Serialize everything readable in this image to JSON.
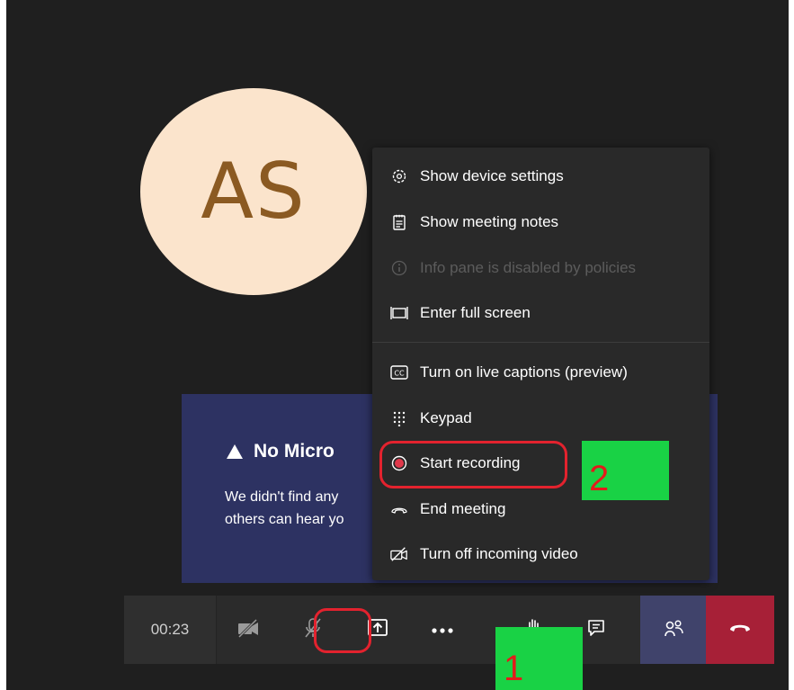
{
  "avatar": {
    "initials": "AS"
  },
  "notice": {
    "title": "No Micro",
    "body": "We didn't find any others can hear yo"
  },
  "menu": {
    "items": [
      {
        "label": "Show device settings",
        "icon": "gear-icon",
        "enabled": true
      },
      {
        "label": "Show meeting notes",
        "icon": "notes-icon",
        "enabled": true
      },
      {
        "label": "Info pane is disabled by policies",
        "icon": "info-icon",
        "enabled": false
      },
      {
        "label": "Enter full screen",
        "icon": "fullscreen-icon",
        "enabled": true
      },
      {
        "label": "Turn on live captions (preview)",
        "icon": "captions-icon",
        "enabled": true
      },
      {
        "label": "Keypad",
        "icon": "keypad-icon",
        "enabled": true
      },
      {
        "label": "Start recording",
        "icon": "record-icon",
        "enabled": true
      },
      {
        "label": "End meeting",
        "icon": "end-call-icon",
        "enabled": true
      },
      {
        "label": "Turn off incoming video",
        "icon": "video-off-icon",
        "enabled": true
      }
    ]
  },
  "annotations": {
    "step1": "1",
    "step2": "2",
    "highlight_color": "#e3222e",
    "callout_color": "#19d245"
  },
  "toolbar": {
    "timer": "00:23",
    "buttons": [
      "camera-off-icon",
      "mic-off-icon",
      "share-icon",
      "more-icon",
      "raise-hand-icon",
      "chat-icon",
      "participants-icon",
      "hang-up-icon"
    ],
    "hangup_color": "#a72037"
  }
}
